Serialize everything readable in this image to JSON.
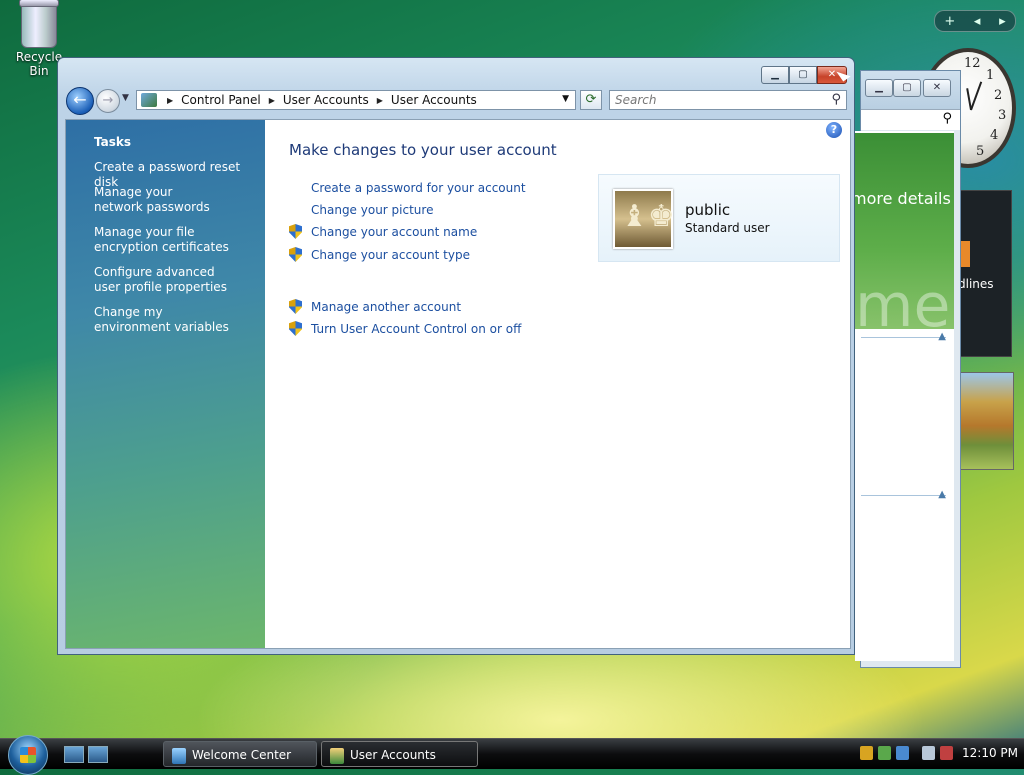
{
  "desktop": {
    "recycle_bin_label": "Recycle Bin"
  },
  "gadgets": {
    "controls": [
      "+",
      "◂",
      "▸"
    ],
    "clock_numbers": [
      "12",
      "1",
      "2",
      "3",
      "4",
      "5"
    ],
    "background_window_snippets": {
      "more_details": "more details",
      "welcome": "me",
      "headlines": "dlines"
    }
  },
  "window": {
    "title": "User Accounts",
    "caption_buttons": {
      "minimize": "▁",
      "maximize": "▢",
      "close": "✕"
    },
    "address": {
      "segments": [
        "Control Panel",
        "User Accounts",
        "User Accounts"
      ]
    },
    "search": {
      "placeholder": "Search"
    },
    "tasks": {
      "heading": "Tasks",
      "items": [
        "Create a password reset disk",
        "Manage your network passwords",
        "Manage your file encryption certificates",
        "Configure advanced user profile properties",
        "Change my environment variables"
      ]
    },
    "main": {
      "heading": "Make changes to your user account",
      "links": [
        {
          "label": "Create a password for your account",
          "shield": false
        },
        {
          "label": "Change your picture",
          "shield": false
        },
        {
          "label": "Change your account name",
          "shield": true
        },
        {
          "label": "Change your account type",
          "shield": true
        }
      ],
      "links2": [
        {
          "label": "Manage another account",
          "shield": true
        },
        {
          "label": "Turn User Account Control on or off",
          "shield": true
        }
      ],
      "account": {
        "name": "public",
        "type": "Standard user"
      }
    }
  },
  "taskbar": {
    "buttons": [
      {
        "label": "Welcome Center",
        "active": false
      },
      {
        "label": "User Accounts",
        "active": true
      }
    ],
    "clock": "12:10 PM"
  },
  "colors": {
    "link": "#1c4fa0",
    "heading": "#1e3a78",
    "task_pane": "#2e6fa5"
  }
}
